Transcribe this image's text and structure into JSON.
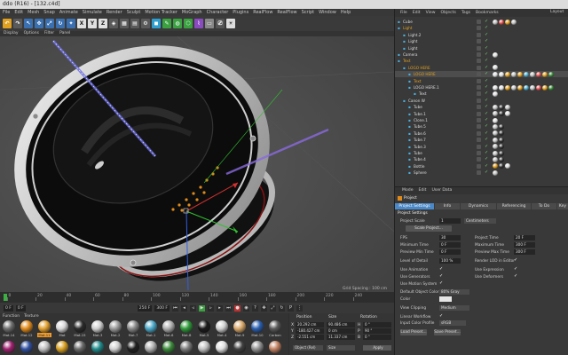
{
  "window": {
    "title": "ddo (R16) - [132.c4d]"
  },
  "menu": [
    "File",
    "Edit",
    "Mesh",
    "Snap",
    "Animate",
    "Simulate",
    "Render",
    "Sculpt",
    "Motion Tracker",
    "MoGraph",
    "Character",
    "Plugins",
    "RealFlow",
    "RealFlow",
    "Script",
    "Window",
    "Help"
  ],
  "toolbar": {
    "x": "X",
    "y": "Y",
    "z": "Z"
  },
  "viewport": {
    "menu": [
      "Display",
      "Options",
      "Filter",
      "Panel"
    ],
    "grid_spacing": "Grid Spacing : 100 cm"
  },
  "timeline": {
    "ticks": [
      "0",
      "20",
      "40",
      "60",
      "80",
      "100",
      "120",
      "140",
      "160",
      "180",
      "200",
      "220",
      "240"
    ]
  },
  "transport": {
    "start": "0 F",
    "current": "0 F",
    "end": "250 F",
    "end2": "300 F"
  },
  "materials": {
    "menu": [
      "Function",
      "Texture"
    ],
    "items": [
      {
        "label": "Mat.14",
        "color": "#6e6e6e"
      },
      {
        "label": "Mat.12",
        "color": "#e08a1a"
      },
      {
        "label": "Mat.11",
        "color": "#e0a030"
      },
      {
        "label": "Mat",
        "color": "#d8d8d8"
      },
      {
        "label": "Mat.15",
        "color": "#2b2b2b"
      },
      {
        "label": "Mat.3",
        "color": "#cfcfcf"
      },
      {
        "label": "Mat.2",
        "color": "#9a9a9a"
      },
      {
        "label": "Mat.7",
        "color": "#888888"
      },
      {
        "label": "Mat.1",
        "color": "#4aa8c8"
      },
      {
        "label": "Mat.6",
        "color": "#b0b0b0"
      },
      {
        "label": "Mat.8",
        "color": "#2f9a3a"
      },
      {
        "label": "Mat.5",
        "color": "#1b1b1b"
      },
      {
        "label": "Mat.4",
        "color": "#d0d0d0"
      },
      {
        "label": "Mat.9",
        "color": "#d9a86a"
      },
      {
        "label": "Mat.10",
        "color": "#2a5fb0"
      },
      {
        "label": "Carbon",
        "color": "#5a5a5a"
      }
    ],
    "row2": [
      "#a02070",
      "#3050a0",
      "#c0c0c0",
      "#d8a020",
      "#6a6a6a",
      "#208a8a",
      "#d0d0d0",
      "#202020",
      "#b0b0b0",
      "#3a8a3a",
      "#7a7a7a",
      "#c0c0c0",
      "#e0e0e0",
      "#404040",
      "#909090",
      "#c08060"
    ]
  },
  "coords": {
    "headers": [
      "Position",
      "Size",
      "Rotation"
    ],
    "rows": [
      {
        "axis": "X",
        "pos": "20.292 cm",
        "size": "90.486 cm",
        "rlabel": "H",
        "rot": "0 °"
      },
      {
        "axis": "Y",
        "pos": "-180.427 cm",
        "size": "0 cm",
        "rlabel": "P",
        "rot": "90 °"
      },
      {
        "axis": "Z",
        "pos": "-2.551 cm",
        "size": "11.337 cm",
        "rlabel": "B",
        "rot": "0 °"
      }
    ],
    "mode1": "Object (Rel)",
    "mode2": "Size",
    "apply": "Apply"
  },
  "objects": {
    "menu": [
      "File",
      "Edit",
      "View",
      "Objects",
      "Tags",
      "Bookmarks"
    ],
    "items": [
      {
        "name": "Cube",
        "indent": 0,
        "color": "#dddddd",
        "tags": [
          "#c0c0c0",
          "#e05050",
          "#e0a020",
          "#c0c0c0"
        ]
      },
      {
        "name": "Light",
        "indent": 0,
        "color": "#e0a020",
        "tags": []
      },
      {
        "name": "Light.2",
        "indent": 1,
        "color": "#dddddd",
        "tags": []
      },
      {
        "name": "Light",
        "indent": 1,
        "color": "#dddddd",
        "tags": []
      },
      {
        "name": "Light",
        "indent": 1,
        "color": "#dddddd",
        "tags": []
      },
      {
        "name": "Camera",
        "indent": 0,
        "color": "#dddddd",
        "tags": [
          "#dddddd"
        ]
      },
      {
        "name": "Text",
        "indent": 0,
        "color": "#e0a020",
        "tags": []
      },
      {
        "name": "LOGO HERE",
        "indent": 1,
        "color": "#e0a020",
        "tags": [
          "#dddddd"
        ]
      },
      {
        "name": "LOGO HERE",
        "indent": 2,
        "color": "#e0a020",
        "tags": [
          "#dddddd",
          "#dddddd",
          "#e0a020",
          "#c0c0c0",
          "#e0a020",
          "#4aa8c8",
          "#c0c0c0",
          "#e05050",
          "#e0a020",
          "#3a8a3a"
        ]
      },
      {
        "name": "Text",
        "indent": 2,
        "color": "#e0a020",
        "tags": []
      },
      {
        "name": "LOGO HERE.1",
        "indent": 2,
        "color": "#dddddd",
        "tags": [
          "#dddddd",
          "#dddddd",
          "#e0a020",
          "#c0c0c0",
          "#e0a020",
          "#4aa8c8",
          "#c0c0c0",
          "#e05050",
          "#e0a020",
          "#3a8a3a"
        ]
      },
      {
        "name": "Text",
        "indent": 3,
        "color": "#dddddd",
        "tags": [
          "#dddddd"
        ]
      },
      {
        "name": "Canon W",
        "indent": 1,
        "color": "#dddddd",
        "tags": []
      },
      {
        "name": "Tube",
        "indent": 2,
        "color": "#dddddd",
        "tags": [
          "#c0c0c0",
          "#303030",
          "#c0c0c0"
        ]
      },
      {
        "name": "Tube.1",
        "indent": 2,
        "color": "#dddddd",
        "tags": [
          "#c0c0c0",
          "#303030",
          "#dddddd"
        ]
      },
      {
        "name": "Clone.1",
        "indent": 2,
        "color": "#dddddd",
        "tags": [
          "#dddddd"
        ]
      },
      {
        "name": "Tube.5",
        "indent": 2,
        "color": "#dddddd",
        "tags": [
          "#c0c0c0",
          "#303030"
        ]
      },
      {
        "name": "Tube.6",
        "indent": 2,
        "color": "#dddddd",
        "tags": [
          "#c0c0c0",
          "#303030"
        ]
      },
      {
        "name": "Tube.7",
        "indent": 2,
        "color": "#dddddd",
        "tags": [
          "#c0c0c0",
          "#303030"
        ]
      },
      {
        "name": "Tube.3",
        "indent": 2,
        "color": "#dddddd",
        "tags": [
          "#c0c0c0",
          "#303030"
        ]
      },
      {
        "name": "Tube",
        "indent": 2,
        "color": "#dddddd",
        "tags": [
          "#c0c0c0",
          "#303030"
        ]
      },
      {
        "name": "Tube.4",
        "indent": 2,
        "color": "#dddddd",
        "tags": [
          "#c0c0c0",
          "#303030"
        ]
      },
      {
        "name": "Bottle",
        "indent": 2,
        "color": "#dddddd",
        "tags": [
          "#e0a020",
          "#303030",
          "#dddddd"
        ]
      },
      {
        "name": "Sphere",
        "indent": 2,
        "color": "#dddddd",
        "tags": [
          "#c0c0c0"
        ]
      }
    ]
  },
  "attributes": {
    "menu": [
      "Mode",
      "Edit",
      "User Data"
    ],
    "title": "Project",
    "tabs": [
      "Project Settings",
      "Info",
      "Dynamics",
      "Referencing",
      "To Do",
      "Key"
    ],
    "section": "Project Settings",
    "scale_label": "Project Scale",
    "scale_value": "1",
    "scale_unit": "Centimeters",
    "scale_btn": "Scale Project...",
    "left": [
      {
        "label": "FPS",
        "value": "30"
      },
      {
        "label": "Minimum Time",
        "value": "0 F"
      },
      {
        "label": "Preview Min Time",
        "value": "0 F"
      },
      {
        "label": "Level of Detail",
        "value": "100 %"
      }
    ],
    "right": [
      {
        "label": "Project Time",
        "value": "20 F"
      },
      {
        "label": "Maximum Time",
        "value": "300 F"
      },
      {
        "label": "Preview Max Time",
        "value": "300 F"
      },
      {
        "label": "Render LOD in Editor",
        "value": ""
      }
    ],
    "checks_left": [
      "Use Animation",
      "Use Generators",
      "Use Motion System"
    ],
    "checks_right": [
      "Use Expression",
      "Use Deformers"
    ],
    "default_color_label": "Default Object Color",
    "default_color_value": "80% Gray",
    "color_label": "Color",
    "view_clipping_label": "View Clipping",
    "view_clipping_value": "Medium",
    "linear_label": "Linear Workflow",
    "input_profile_label": "Input Color Profile",
    "input_profile_value": "sRGB",
    "load_btn": "Load Preset...",
    "save_btn": "Save Preset...",
    "layout_label": "Layout"
  }
}
